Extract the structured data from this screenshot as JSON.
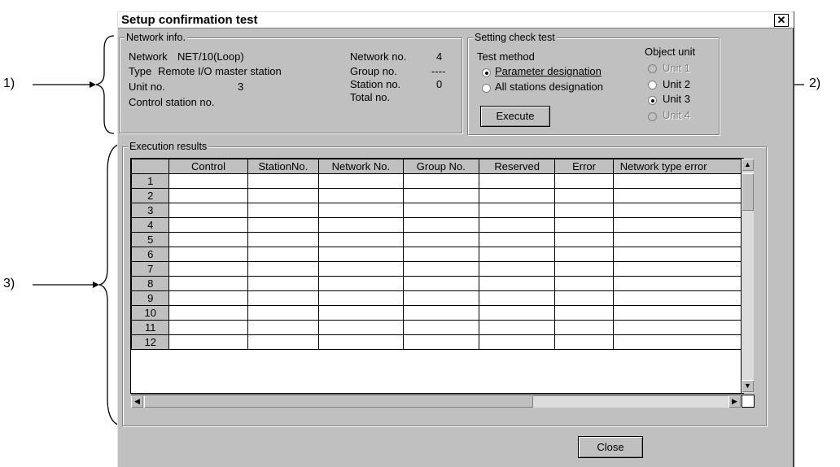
{
  "dialog": {
    "title": "Setup confirmation test",
    "close_icon": "✕"
  },
  "network_info": {
    "label": "Network info.",
    "network_label": "Network",
    "network_value": "NET/10(Loop)",
    "type_label": "Type",
    "type_value": "Remote I/O master station",
    "unit_label": "Unit no.",
    "unit_value": "3",
    "control_station_label": "Control station no.",
    "network_no_label": "Network no.",
    "network_no_value": "4",
    "group_no_label": "Group no.",
    "group_no_value": "----",
    "station_no_label": "Station no.",
    "station_no_value": "0",
    "total_no_label": "Total no."
  },
  "setting_check": {
    "label": "Setting check test",
    "test_method_label": "Test method",
    "param_designation": "Parameter designation",
    "all_stations": "All stations designation",
    "execute": "Execute",
    "object_unit_label": "Object unit",
    "units": [
      "Unit 1",
      "Unit 2",
      "Unit 3",
      "Unit 4"
    ],
    "selected_unit": "Unit 3",
    "selected_method": "Parameter designation"
  },
  "results": {
    "label": "Execution results",
    "columns": [
      "Control",
      "StationNo.",
      "Network No.",
      "Group No.",
      "Reserved",
      "Error",
      "Network type error"
    ],
    "rows": [
      "1",
      "2",
      "3",
      "4",
      "5",
      "6",
      "7",
      "8",
      "9",
      "10",
      "11",
      "12"
    ]
  },
  "close_button": "Close",
  "callouts": [
    "1)",
    "2)",
    "3)"
  ]
}
